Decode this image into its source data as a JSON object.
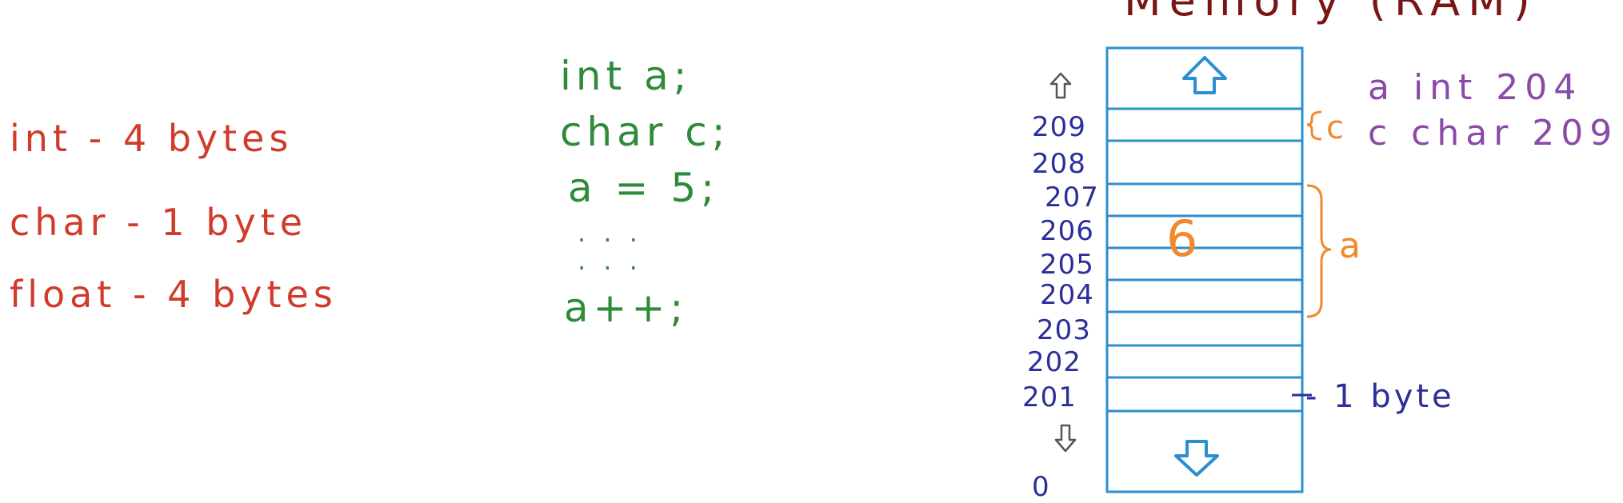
{
  "title": "Memory (RAM)",
  "data_sizes": [
    "int - 4 bytes",
    "char - 1 byte",
    "float - 4 bytes"
  ],
  "code_lines": [
    "int a;",
    "char c;",
    "a = 5;",
    ". . .",
    ". . .",
    "a++;"
  ],
  "memory": {
    "addresses": [
      "209",
      "208",
      "207",
      "206",
      "205",
      "204",
      "203",
      "202",
      "201"
    ],
    "bottom_address": "0",
    "stored_value": "6",
    "var_a_label": "a",
    "var_c_label": "c",
    "cell_size_label": "- 1 byte"
  },
  "symbol_table": [
    "a int 204",
    "c char 209"
  ],
  "colors": {
    "sizes_text": "#d13b2b",
    "code_text": "#2e8b3a",
    "address_text": "#2b2f9a",
    "memory_lines": "#2b8fd0",
    "brace": "#f08a2b",
    "stored_value": "#f08a2b",
    "symbol_table_text": "#8a4aa8",
    "title_text": "#7a1515",
    "arrow_icon": "#2b8fd0",
    "small_arrow": "#555555"
  },
  "icons": {
    "memory_top_arrow": "up-arrow-icon",
    "memory_bottom_arrow": "down-arrow-icon",
    "address_up_arrow": "small-up-arrow-icon",
    "address_down_arrow": "small-down-arrow-icon"
  }
}
